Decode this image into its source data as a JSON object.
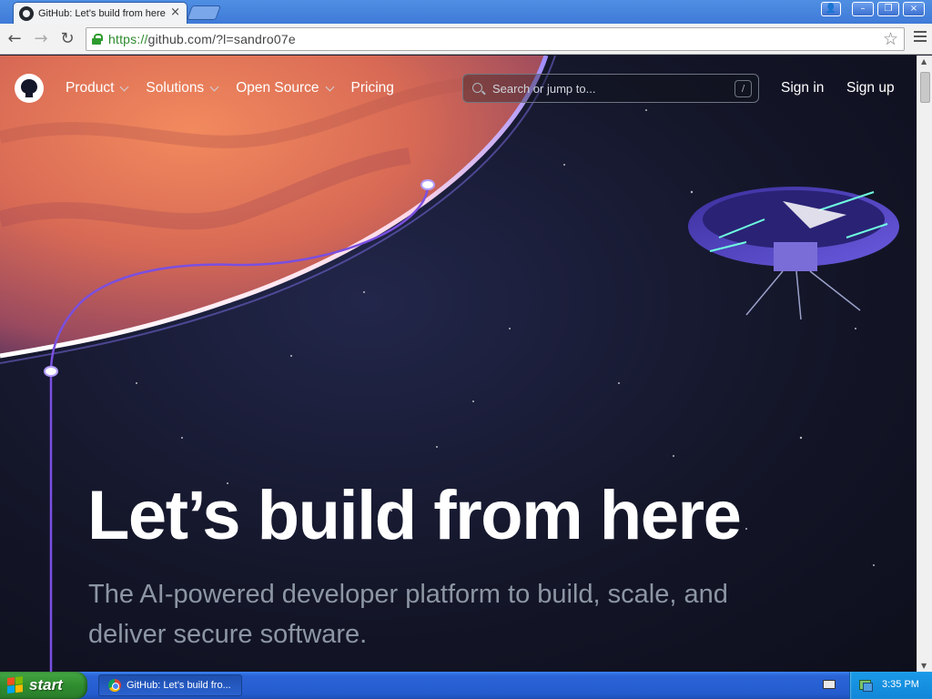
{
  "browser": {
    "tab_title": "GitHub: Let’s build from here",
    "tab_close": "×",
    "url_scheme": "https://",
    "url_rest": "github.com/?l=sandro07e",
    "window_buttons": [
      "–",
      "❐",
      "×"
    ]
  },
  "github": {
    "nav": [
      {
        "label": "Product",
        "has_menu": true
      },
      {
        "label": "Solutions",
        "has_menu": true
      },
      {
        "label": "Open Source",
        "has_menu": true
      },
      {
        "label": "Pricing",
        "has_menu": false
      }
    ],
    "search_placeholder": "Search or jump to...",
    "search_shortcut": "/",
    "sign_in": "Sign in",
    "sign_up": "Sign up"
  },
  "hero": {
    "title": "Let’s build from here",
    "subtitle": "The AI-powered developer platform to build, scale, and deliver secure software."
  },
  "taskbar": {
    "start_label": "start",
    "task_label": "GitHub: Let’s build fro...",
    "clock": "3:35 PM"
  },
  "colors": {
    "page_bg": "#141629",
    "link_line": "#7a4fe0",
    "planet": "#e0765a",
    "hero_subtitle": "#8d96a3"
  }
}
